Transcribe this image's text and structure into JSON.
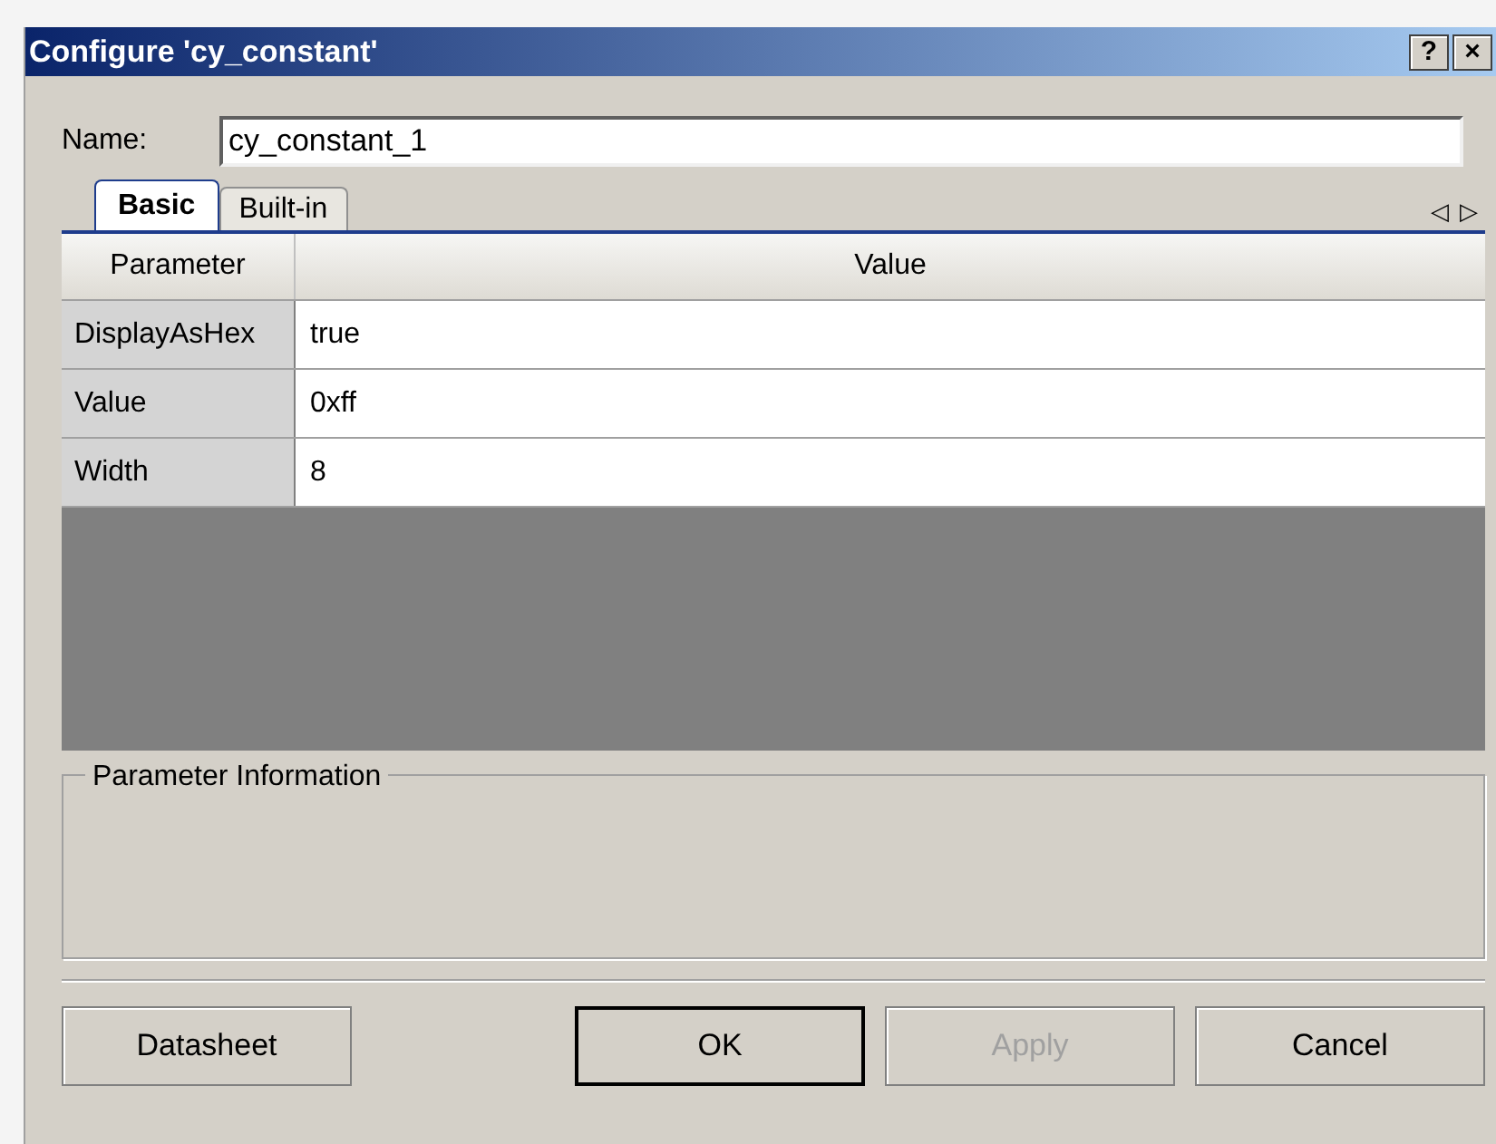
{
  "window": {
    "title": "Configure 'cy_constant'",
    "title_buttons": [
      "?",
      "×"
    ]
  },
  "name_field": {
    "label": "Name:",
    "value": "cy_constant_1"
  },
  "tabs": [
    {
      "label": "Basic",
      "selected": true
    },
    {
      "label": "Built-in",
      "selected": false
    }
  ],
  "tab_scroll": [
    "◁",
    "▷"
  ],
  "table": {
    "columns": [
      "Parameter",
      "Value"
    ],
    "rows": [
      [
        "DisplayAsHex",
        "true"
      ],
      [
        "Value",
        "0xff"
      ],
      [
        "Width",
        "8"
      ]
    ]
  },
  "info_group": {
    "title": "Parameter Information"
  },
  "buttons": [
    {
      "label": "Datasheet",
      "default": false,
      "disabled": false
    },
    {
      "label": "OK",
      "default": true,
      "disabled": false
    },
    {
      "label": "Apply",
      "default": false,
      "disabled": true
    },
    {
      "label": "Cancel",
      "default": false,
      "disabled": false
    }
  ]
}
